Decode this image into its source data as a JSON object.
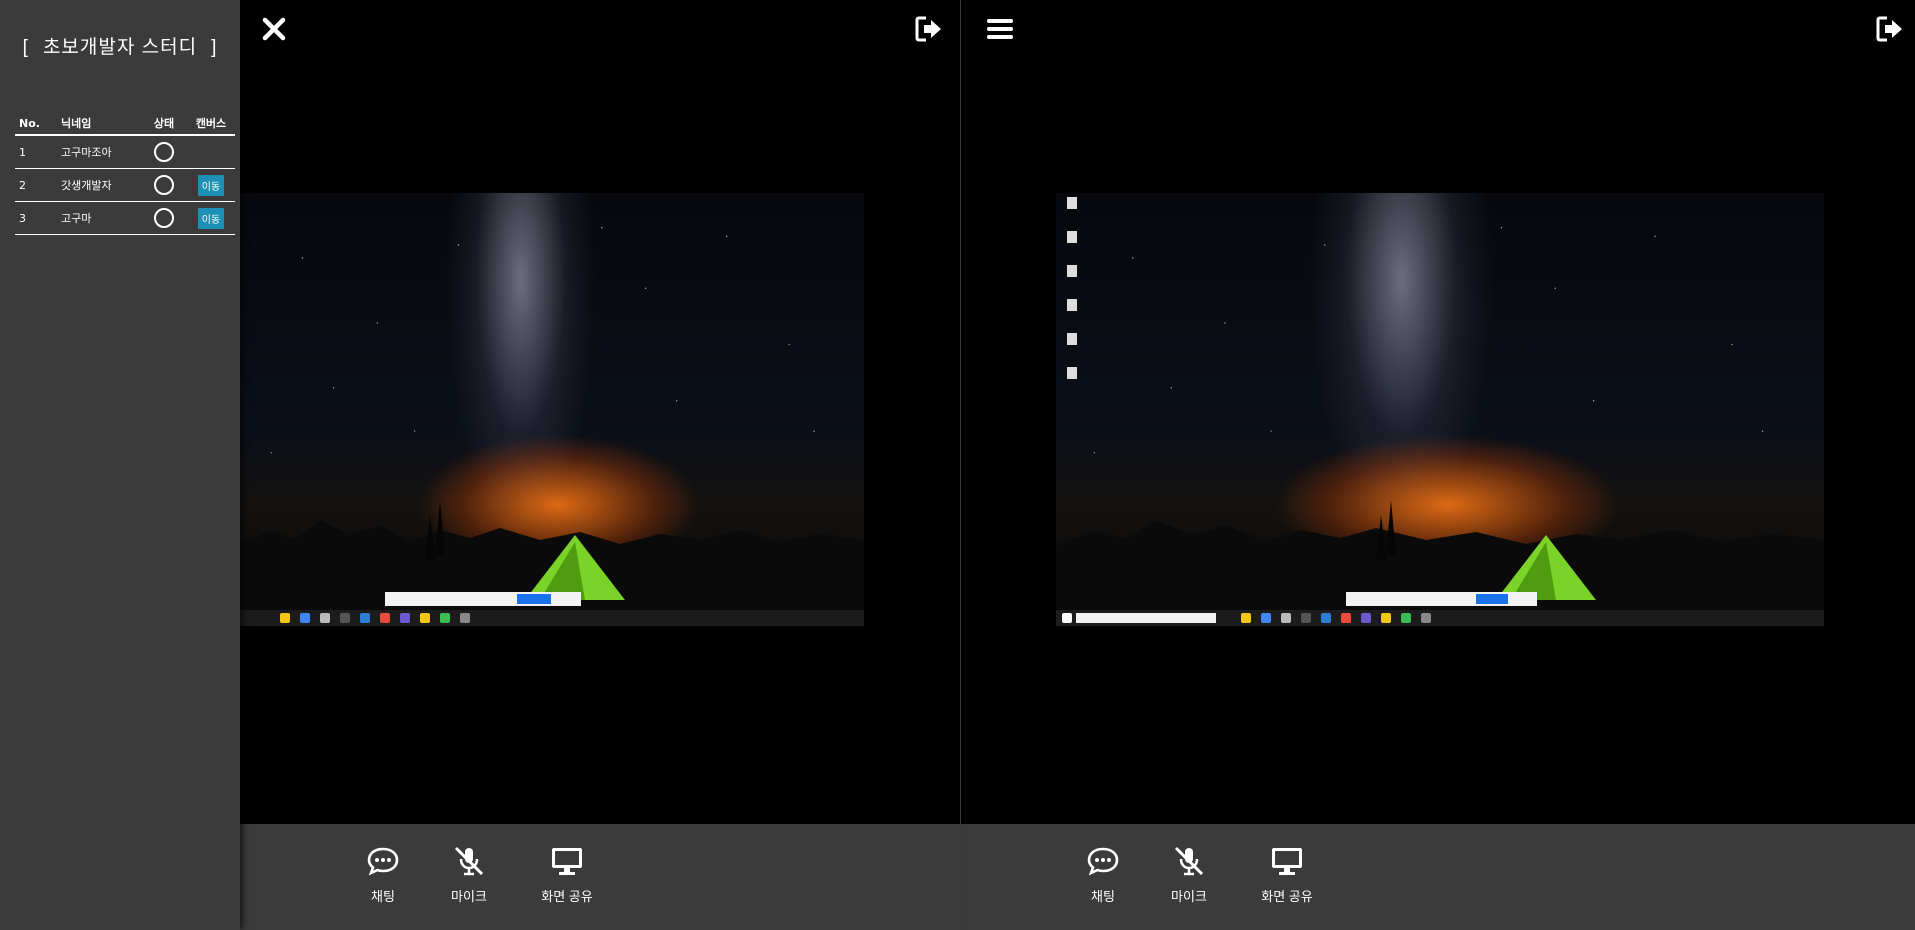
{
  "sidebar": {
    "title": "초보개발자 스터디",
    "bracket_open": "[",
    "bracket_close": "]",
    "headers": {
      "no": "No.",
      "nickname": "닉네임",
      "status": "상태",
      "canvas": "캔버스"
    },
    "rows": [
      {
        "no": "1",
        "nickname": "고구마조아",
        "move_label": ""
      },
      {
        "no": "2",
        "nickname": "갓생개발자",
        "move_label": "이동"
      },
      {
        "no": "3",
        "nickname": "고구마",
        "move_label": "이동"
      }
    ]
  },
  "controls": {
    "chat": "채팅",
    "mic": "마이크",
    "screen_share": "화면 공유"
  },
  "icons": {
    "close": "close-icon",
    "exit": "exit-icon",
    "menu": "menu-icon",
    "chat": "chat-bubble-icon",
    "mic_muted": "mic-off-icon",
    "monitor": "monitor-icon"
  },
  "colors": {
    "panel_bg": "#3b3b3b",
    "move_button": "#1e90b5",
    "video_bg": "#000000"
  }
}
